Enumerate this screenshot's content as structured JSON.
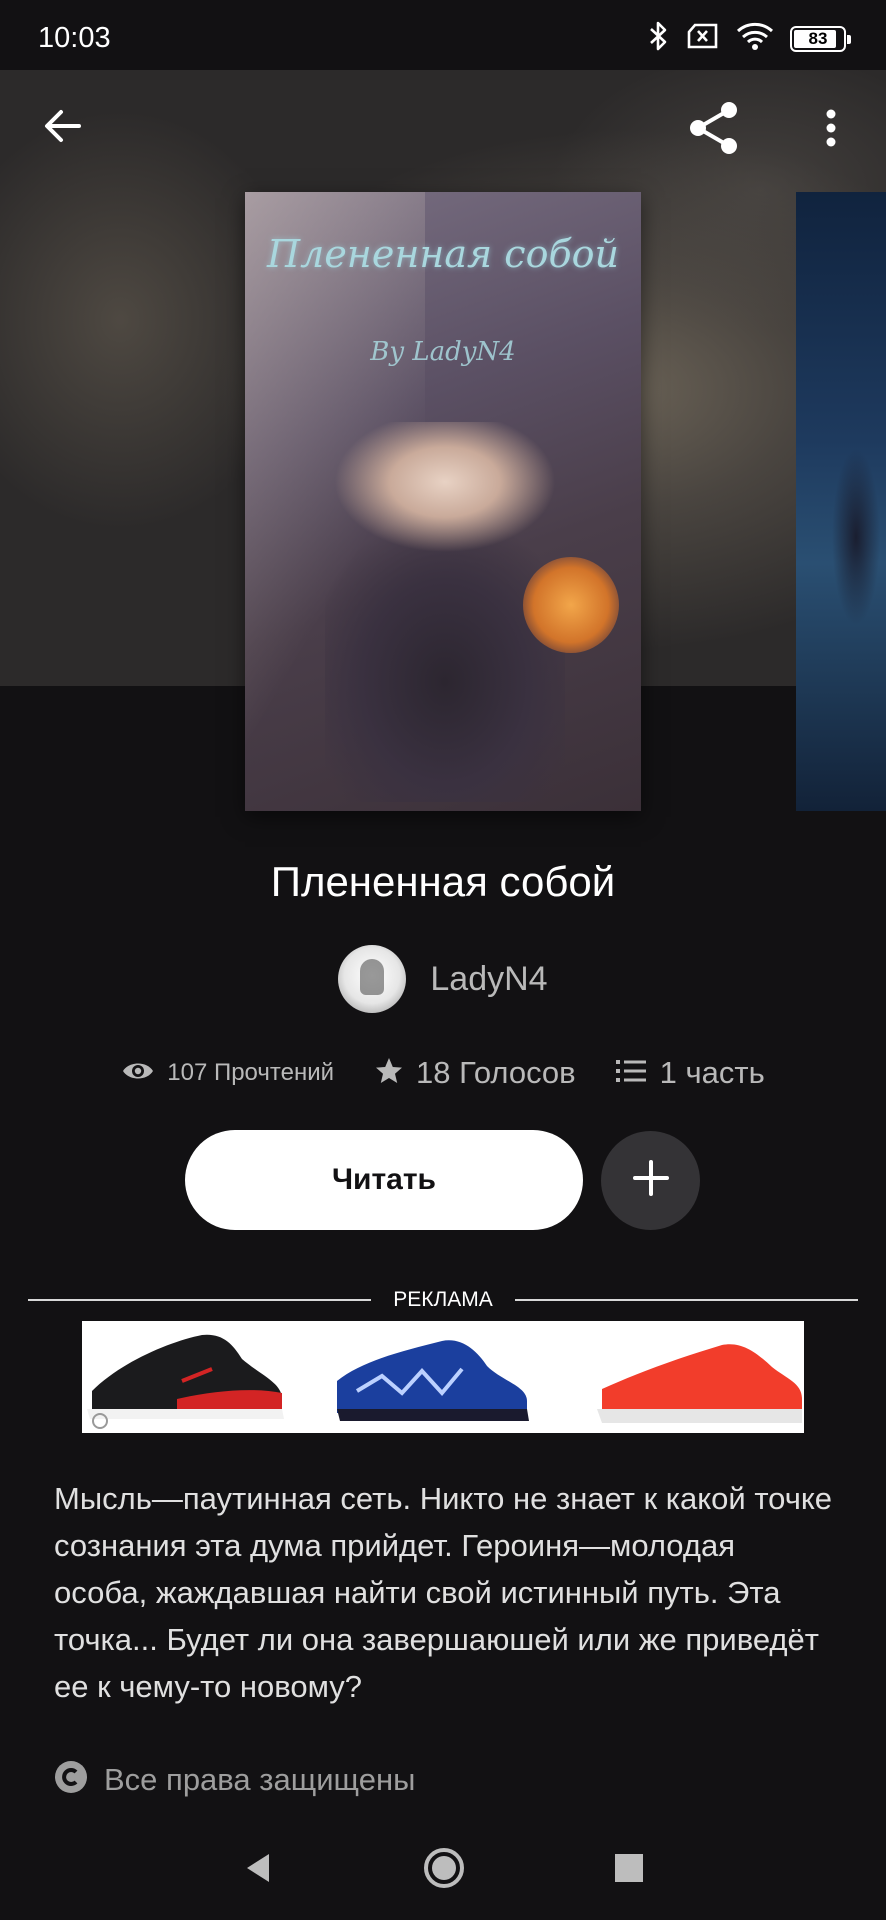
{
  "status_bar": {
    "time": "10:03",
    "battery_level": "83",
    "icons": [
      "bluetooth-icon",
      "no-sim-icon",
      "wifi-icon",
      "battery-icon"
    ]
  },
  "toolbar": {
    "back_icon": "arrow-left-icon",
    "share_icon": "share-icon",
    "more_icon": "more-vertical-icon"
  },
  "cover": {
    "title": "Плененная собой",
    "author": "By LadyN4"
  },
  "book": {
    "title": "Плененная собой",
    "author": "LadyN4"
  },
  "stats": {
    "reads": "107 Прочтений",
    "votes": "18 Голосов",
    "parts": "1 часть"
  },
  "actions": {
    "read_label": "Читать",
    "add_icon": "plus-icon"
  },
  "ad": {
    "label": "РЕКЛАМА"
  },
  "description": "Мысль—паутинная сеть. Никто не знает к какой точке сознания эта дума прийдет. Героиня—молодая особа, жаждавшая найти свой истинный путь. Эта точка... Будет ли она завершаюшей или же приведёт ее к чему-то новому?",
  "copyright": {
    "text": "Все права защищены"
  },
  "colors": {
    "background": "#121113",
    "accent_button": "#ffffff",
    "secondary_text": "#b9b9b9"
  }
}
